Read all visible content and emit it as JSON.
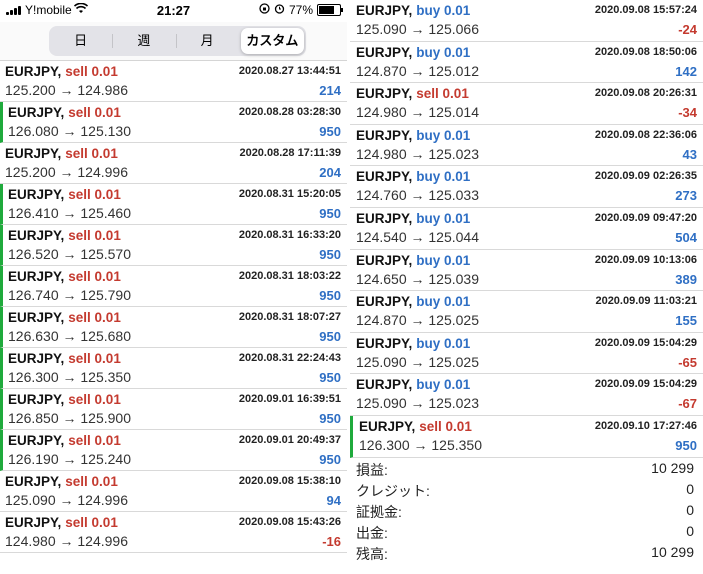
{
  "status_bar": {
    "carrier": "Y!mobile",
    "time": "21:27",
    "battery": "77%",
    "battery_level": 0.77
  },
  "tabs": [
    {
      "label": "日",
      "active": false
    },
    {
      "label": "週",
      "active": false
    },
    {
      "label": "月",
      "active": false
    },
    {
      "label": "カスタム",
      "active": true
    }
  ],
  "left_trades": [
    {
      "symbol": "EURJPY,",
      "side": "sell 0.01",
      "type": "sell",
      "date": "2020.08.27 13:44:51",
      "prices": "125.200 → 124.986",
      "profit": "214",
      "profit_sign": "pos",
      "marked": false
    },
    {
      "symbol": "EURJPY,",
      "side": "sell 0.01",
      "type": "sell",
      "date": "2020.08.28 03:28:30",
      "prices": "126.080 → 125.130",
      "profit": "950",
      "profit_sign": "pos",
      "marked": true
    },
    {
      "symbol": "EURJPY,",
      "side": "sell 0.01",
      "type": "sell",
      "date": "2020.08.28 17:11:39",
      "prices": "125.200 → 124.996",
      "profit": "204",
      "profit_sign": "pos",
      "marked": false
    },
    {
      "symbol": "EURJPY,",
      "side": "sell 0.01",
      "type": "sell",
      "date": "2020.08.31 15:20:05",
      "prices": "126.410 → 125.460",
      "profit": "950",
      "profit_sign": "pos",
      "marked": true
    },
    {
      "symbol": "EURJPY,",
      "side": "sell 0.01",
      "type": "sell",
      "date": "2020.08.31 16:33:20",
      "prices": "126.520 → 125.570",
      "profit": "950",
      "profit_sign": "pos",
      "marked": true
    },
    {
      "symbol": "EURJPY,",
      "side": "sell 0.01",
      "type": "sell",
      "date": "2020.08.31 18:03:22",
      "prices": "126.740 → 125.790",
      "profit": "950",
      "profit_sign": "pos",
      "marked": true
    },
    {
      "symbol": "EURJPY,",
      "side": "sell 0.01",
      "type": "sell",
      "date": "2020.08.31 18:07:27",
      "prices": "126.630 → 125.680",
      "profit": "950",
      "profit_sign": "pos",
      "marked": true
    },
    {
      "symbol": "EURJPY,",
      "side": "sell 0.01",
      "type": "sell",
      "date": "2020.08.31 22:24:43",
      "prices": "126.300 → 125.350",
      "profit": "950",
      "profit_sign": "pos",
      "marked": true
    },
    {
      "symbol": "EURJPY,",
      "side": "sell 0.01",
      "type": "sell",
      "date": "2020.09.01 16:39:51",
      "prices": "126.850 → 125.900",
      "profit": "950",
      "profit_sign": "pos",
      "marked": true
    },
    {
      "symbol": "EURJPY,",
      "side": "sell 0.01",
      "type": "sell",
      "date": "2020.09.01 20:49:37",
      "prices": "126.190 → 125.240",
      "profit": "950",
      "profit_sign": "pos",
      "marked": true
    },
    {
      "symbol": "EURJPY,",
      "side": "sell 0.01",
      "type": "sell",
      "date": "2020.09.08 15:38:10",
      "prices": "125.090 → 124.996",
      "profit": "94",
      "profit_sign": "pos",
      "marked": false
    },
    {
      "symbol": "EURJPY,",
      "side": "sell 0.01",
      "type": "sell",
      "date": "2020.09.08 15:43:26",
      "prices": "124.980 → 124.996",
      "profit": "-16",
      "profit_sign": "neg",
      "marked": false
    }
  ],
  "right_trades": [
    {
      "symbol": "EURJPY,",
      "side": "buy 0.01",
      "type": "buy",
      "date": "2020.09.08 15:57:24",
      "prices": "125.090 → 125.066",
      "profit": "-24",
      "profit_sign": "neg",
      "marked": false
    },
    {
      "symbol": "EURJPY,",
      "side": "buy 0.01",
      "type": "buy",
      "date": "2020.09.08 18:50:06",
      "prices": "124.870 → 125.012",
      "profit": "142",
      "profit_sign": "pos",
      "marked": false
    },
    {
      "symbol": "EURJPY,",
      "side": "sell 0.01",
      "type": "sell",
      "date": "2020.09.08 20:26:31",
      "prices": "124.980 → 125.014",
      "profit": "-34",
      "profit_sign": "neg",
      "marked": false
    },
    {
      "symbol": "EURJPY,",
      "side": "buy 0.01",
      "type": "buy",
      "date": "2020.09.08 22:36:06",
      "prices": "124.980 → 125.023",
      "profit": "43",
      "profit_sign": "pos",
      "marked": false
    },
    {
      "symbol": "EURJPY,",
      "side": "buy 0.01",
      "type": "buy",
      "date": "2020.09.09 02:26:35",
      "prices": "124.760 → 125.033",
      "profit": "273",
      "profit_sign": "pos",
      "marked": false
    },
    {
      "symbol": "EURJPY,",
      "side": "buy 0.01",
      "type": "buy",
      "date": "2020.09.09 09:47:20",
      "prices": "124.540 → 125.044",
      "profit": "504",
      "profit_sign": "pos",
      "marked": false
    },
    {
      "symbol": "EURJPY,",
      "side": "buy 0.01",
      "type": "buy",
      "date": "2020.09.09 10:13:06",
      "prices": "124.650 → 125.039",
      "profit": "389",
      "profit_sign": "pos",
      "marked": false
    },
    {
      "symbol": "EURJPY,",
      "side": "buy 0.01",
      "type": "buy",
      "date": "2020.09.09 11:03:21",
      "prices": "124.870 → 125.025",
      "profit": "155",
      "profit_sign": "pos",
      "marked": false
    },
    {
      "symbol": "EURJPY,",
      "side": "buy 0.01",
      "type": "buy",
      "date": "2020.09.09 15:04:29",
      "prices": "125.090 → 125.025",
      "profit": "-65",
      "profit_sign": "neg",
      "marked": false
    },
    {
      "symbol": "EURJPY,",
      "side": "buy 0.01",
      "type": "buy",
      "date": "2020.09.09 15:04:29",
      "prices": "125.090 → 125.023",
      "profit": "-67",
      "profit_sign": "neg",
      "marked": false
    },
    {
      "symbol": "EURJPY,",
      "side": "sell 0.01",
      "type": "sell",
      "date": "2020.09.10 17:27:46",
      "prices": "126.300 → 125.350",
      "profit": "950",
      "profit_sign": "pos",
      "marked": true
    }
  ],
  "summary": [
    {
      "label": "損益:",
      "value": "10 299"
    },
    {
      "label": "クレジット:",
      "value": "0"
    },
    {
      "label": "証拠金:",
      "value": "0"
    },
    {
      "label": "出金:",
      "value": "0"
    },
    {
      "label": "残高:",
      "value": "10 299"
    }
  ],
  "colors": {
    "sell": "#c43a2f",
    "buy": "#2f6fc4",
    "profit_positive": "#2f6fc4",
    "profit_negative": "#c43a2f",
    "marker": "#1faa3c"
  }
}
